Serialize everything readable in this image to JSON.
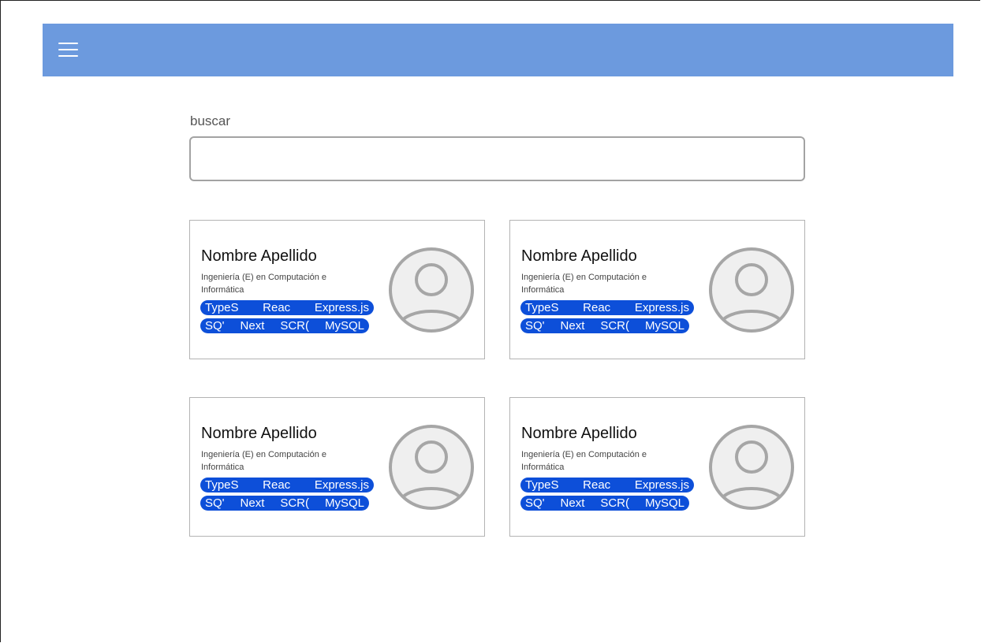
{
  "menu": {
    "icon": "hamburger-menu-icon"
  },
  "search": {
    "label": "buscar",
    "value": "",
    "placeholder": ""
  },
  "cards": [
    {
      "name": "Nombre Apellido",
      "career": "Ingeniería (E) en Computación e Informática",
      "tags_row1": [
        "TypeS",
        "Reac",
        "Express.js"
      ],
      "tags_row2": [
        "SQ'",
        "Next",
        "SCR(",
        "MySQL"
      ],
      "avatar_icon": "user-avatar-icon"
    },
    {
      "name": "Nombre Apellido",
      "career": "Ingeniería (E) en Computación e Informática",
      "tags_row1": [
        "TypeS",
        "Reac",
        "Express.js"
      ],
      "tags_row2": [
        "SQ'",
        "Next",
        "SCR(",
        "MySQL"
      ],
      "avatar_icon": "user-avatar-icon"
    },
    {
      "name": "Nombre Apellido",
      "career": "Ingeniería (E) en Computación e Informática",
      "tags_row1": [
        "TypeS",
        "Reac",
        "Express.js"
      ],
      "tags_row2": [
        "SQ'",
        "Next",
        "SCR(",
        "MySQL"
      ],
      "avatar_icon": "user-avatar-icon"
    },
    {
      "name": "Nombre Apellido",
      "career": "Ingeniería (E) en Computación e Informática",
      "tags_row1": [
        "TypeS",
        "Reac",
        "Express.js"
      ],
      "tags_row2": [
        "SQ'",
        "Next",
        "SCR(",
        "MySQL"
      ],
      "avatar_icon": "user-avatar-icon"
    }
  ],
  "colors": {
    "topbar": "#6c9ade",
    "tag_background": "#0d4fd9",
    "avatar": "#a6a6a6"
  }
}
